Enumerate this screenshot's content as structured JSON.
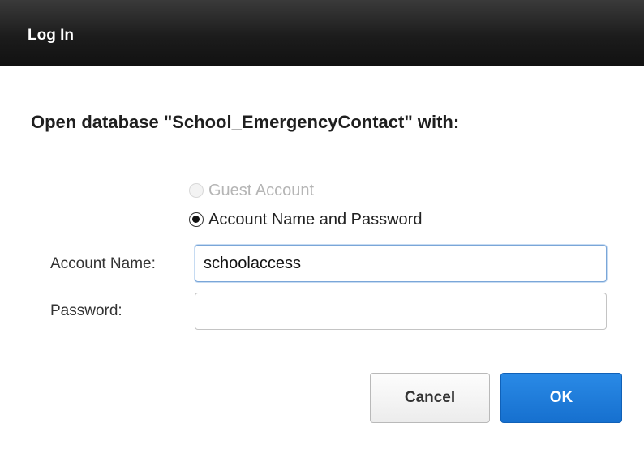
{
  "dialog": {
    "title": "Log In"
  },
  "heading": "Open database \"School_EmergencyContact\" with:",
  "options": {
    "guest_label": "Guest Account",
    "guest_enabled": false,
    "account_label": "Account Name and Password",
    "selected": "account"
  },
  "fields": {
    "account_name_label": "Account Name:",
    "account_name_value": "schoolaccess",
    "password_label": "Password:",
    "password_value": ""
  },
  "buttons": {
    "cancel_label": "Cancel",
    "ok_label": "OK"
  },
  "colors": {
    "titlebar": "#1c1c1c",
    "ok_button": "#1670cf",
    "focus_border": "#7aa6d8"
  }
}
